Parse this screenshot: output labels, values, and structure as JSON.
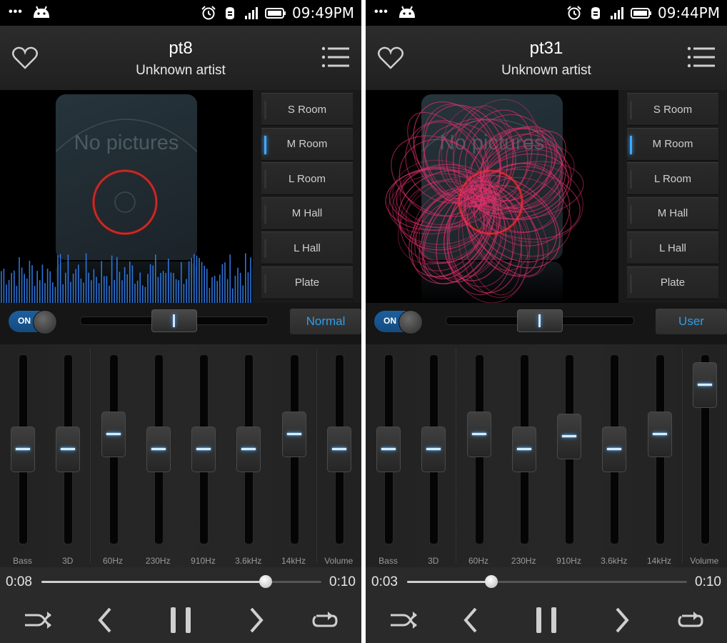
{
  "screens": [
    {
      "status_time": "09:49PM",
      "track_title": "pt8",
      "artist": "Unknown artist",
      "album_placeholder": "No pictures",
      "visualizer": "spectrum",
      "presets": [
        {
          "label": "S Room",
          "active": false
        },
        {
          "label": "M Room",
          "active": true
        },
        {
          "label": "L Room",
          "active": false
        },
        {
          "label": "M Hall",
          "active": false
        },
        {
          "label": "L Hall",
          "active": false
        },
        {
          "label": "Plate",
          "active": false
        }
      ],
      "toggle_label": "ON",
      "balance_fraction": 0.5,
      "eq_mode": "Normal",
      "bands": [
        {
          "label": "Bass",
          "level": 0.5
        },
        {
          "label": "3D",
          "level": 0.5
        },
        {
          "label": "60Hz",
          "level": 0.58
        },
        {
          "label": "230Hz",
          "level": 0.5
        },
        {
          "label": "910Hz",
          "level": 0.5
        },
        {
          "label": "3.6kHz",
          "level": 0.5
        },
        {
          "label": "14kHz",
          "level": 0.58
        },
        {
          "label": "Volume",
          "level": 0.5
        }
      ],
      "elapsed": "0:08",
      "total": "0:10",
      "progress_fraction": 0.8
    },
    {
      "status_time": "09:44PM",
      "track_title": "pt31",
      "artist": "Unknown artist",
      "album_placeholder": "No pictures",
      "visualizer": "rose",
      "presets": [
        {
          "label": "S Room",
          "active": false
        },
        {
          "label": "M Room",
          "active": true
        },
        {
          "label": "L Room",
          "active": false
        },
        {
          "label": "M Hall",
          "active": false
        },
        {
          "label": "L Hall",
          "active": false
        },
        {
          "label": "Plate",
          "active": false
        }
      ],
      "toggle_label": "ON",
      "balance_fraction": 0.5,
      "eq_mode": "User",
      "bands": [
        {
          "label": "Bass",
          "level": 0.5
        },
        {
          "label": "3D",
          "level": 0.5
        },
        {
          "label": "60Hz",
          "level": 0.58
        },
        {
          "label": "230Hz",
          "level": 0.5
        },
        {
          "label": "910Hz",
          "level": 0.57
        },
        {
          "label": "3.6kHz",
          "level": 0.5
        },
        {
          "label": "14kHz",
          "level": 0.58
        },
        {
          "label": "Volume",
          "level": 0.84
        }
      ],
      "elapsed": "0:03",
      "total": "0:10",
      "progress_fraction": 0.3
    }
  ],
  "colors": {
    "accent": "#3fa8ff",
    "mode_text": "#2f9de8",
    "toggle_on": "#1b5fa0",
    "rose": "#e0306a"
  },
  "icons": {
    "status_left": [
      "more-dots-icon",
      "android-icon"
    ],
    "status_right": [
      "alarm-icon",
      "usb-debug-icon",
      "signal-icon",
      "battery-icon"
    ],
    "header": [
      "heart-icon",
      "playlist-menu-icon"
    ],
    "transport": [
      "shuffle-icon",
      "previous-icon",
      "pause-icon",
      "next-icon",
      "repeat-icon"
    ]
  }
}
